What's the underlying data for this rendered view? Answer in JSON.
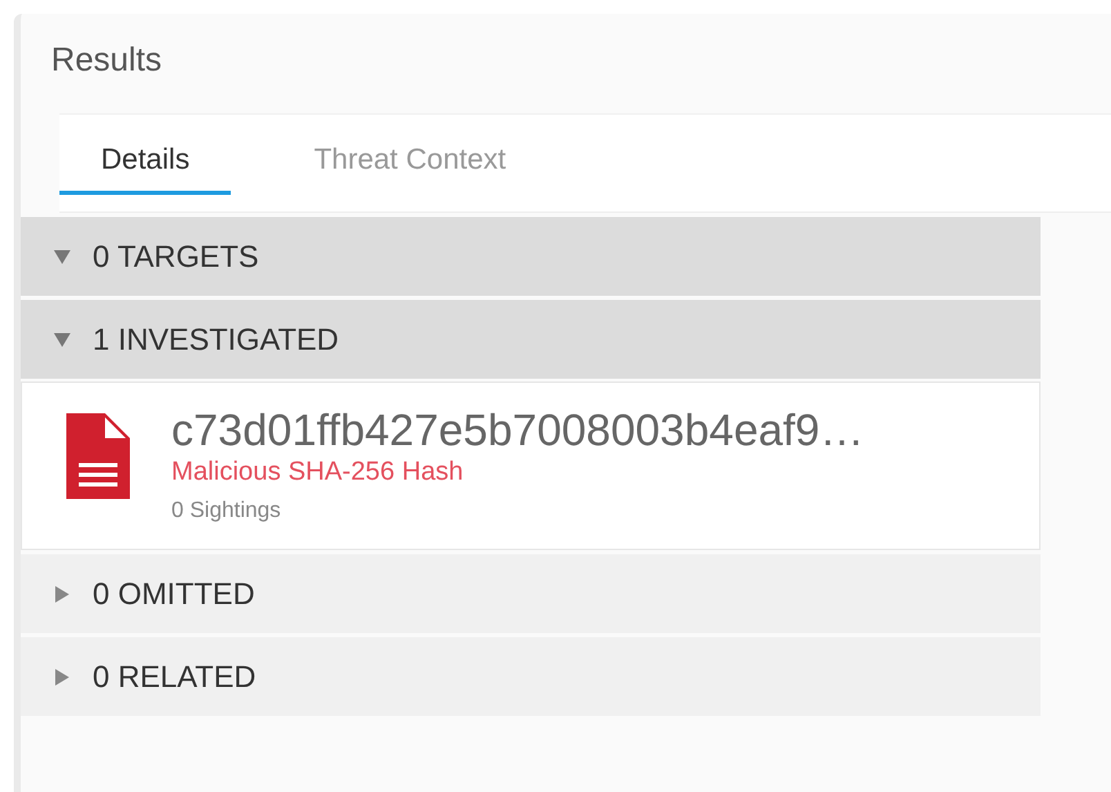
{
  "panel": {
    "title": "Results"
  },
  "tabs": [
    {
      "label": "Details",
      "selected": true
    },
    {
      "label": "Threat Context",
      "selected": false
    }
  ],
  "sections": [
    {
      "label": "0 TARGETS",
      "expanded": true
    },
    {
      "label": "1 INVESTIGATED",
      "expanded": true,
      "items": [
        {
          "hash": "c73d01ffb427e5b7008003b4eaf9…",
          "verdict": "Malicious SHA-256 Hash",
          "sightings": "0 Sightings"
        }
      ]
    },
    {
      "label": "0 OMITTED",
      "expanded": false
    },
    {
      "label": "0 RELATED",
      "expanded": false
    }
  ]
}
